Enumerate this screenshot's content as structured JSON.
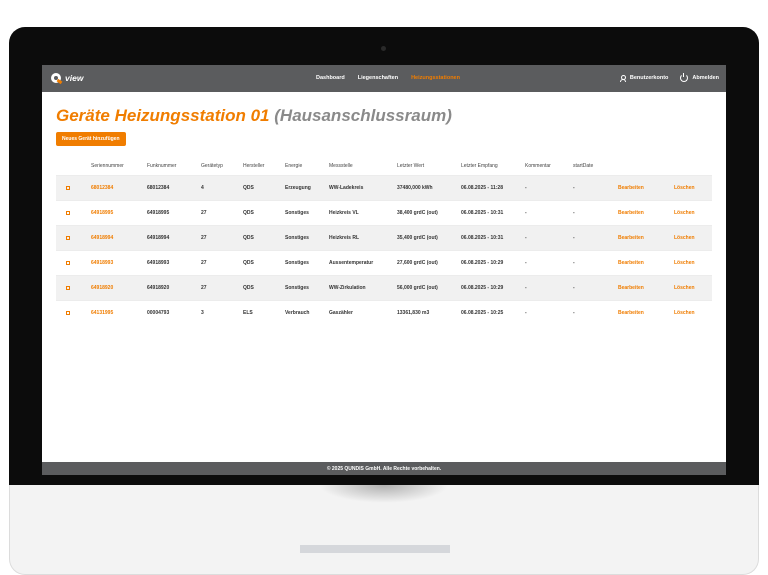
{
  "nav": {
    "logo_text": "view",
    "links": [
      "Dashboard",
      "Liegenschaften",
      "Heizungsstationen"
    ],
    "active_index": 2,
    "account_label": "Benutzerkonto",
    "logout_label": "Abmelden"
  },
  "page": {
    "title_main": "Geräte Heizungsstation 01",
    "title_sub": "(Hausanschlussraum)",
    "add_button_label": "Neues Gerät hinzufügen"
  },
  "table": {
    "headers": [
      "Seriennummer",
      "Funknummer",
      "Gerätetyp",
      "Hersteller",
      "Energie",
      "Messstelle",
      "Letzter Wert",
      "Letzter Empfang",
      "Kommentar",
      "startDate"
    ],
    "rows": [
      {
        "serial": "68012384",
        "radio": "68012384",
        "type": "4",
        "maker": "QDS",
        "energy": "Erzeugung",
        "point": "WW-Ladekreis",
        "value": "37480,000 kWh",
        "received": "06.08.2025 - 11:28",
        "comment": "-",
        "start": "-",
        "edit": "Bearbeiten",
        "delete": "Löschen"
      },
      {
        "serial": "64918995",
        "radio": "64918995",
        "type": "27",
        "maker": "QDS",
        "energy": "Sonstiges",
        "point": "Heizkreis VL",
        "value": "38,400 grdC (out)",
        "received": "06.08.2025 - 10:31",
        "comment": "-",
        "start": "-",
        "edit": "Bearbeiten",
        "delete": "Löschen"
      },
      {
        "serial": "64918994",
        "radio": "64918994",
        "type": "27",
        "maker": "QDS",
        "energy": "Sonstiges",
        "point": "Heizkreis RL",
        "value": "35,400 grdC (out)",
        "received": "06.08.2025 - 10:31",
        "comment": "-",
        "start": "-",
        "edit": "Bearbeiten",
        "delete": "Löschen"
      },
      {
        "serial": "64918993",
        "radio": "64918993",
        "type": "27",
        "maker": "QDS",
        "energy": "Sonstiges",
        "point": "Aussentemperatur",
        "value": "27,600 grdC (out)",
        "received": "06.08.2025 - 10:29",
        "comment": "-",
        "start": "-",
        "edit": "Bearbeiten",
        "delete": "Löschen"
      },
      {
        "serial": "64918920",
        "radio": "64918920",
        "type": "27",
        "maker": "QDS",
        "energy": "Sonstiges",
        "point": "WW-Zirkulation",
        "value": "56,000 grdC (out)",
        "received": "06.08.2025 - 10:29",
        "comment": "-",
        "start": "-",
        "edit": "Bearbeiten",
        "delete": "Löschen"
      },
      {
        "serial": "64131995",
        "radio": "00004793",
        "type": "3",
        "maker": "ELS",
        "energy": "Verbrauch",
        "point": "Gaszähler",
        "value": "13361,830 m3",
        "received": "06.08.2025 - 10:25",
        "comment": "-",
        "start": "-",
        "edit": "Bearbeiten",
        "delete": "Löschen"
      }
    ]
  },
  "footer": {
    "text": "© 2025 QUNDIS GmbH. Alle Rechte vorbehalten."
  },
  "colors": {
    "accent": "#f07d00",
    "navbar": "#5b5c5e",
    "row_shade": "#f1f1f1"
  },
  "icons": {
    "logo": "qview-logo-icon",
    "account": "user-icon",
    "logout": "power-icon",
    "row_select": "checkbox-icon"
  }
}
